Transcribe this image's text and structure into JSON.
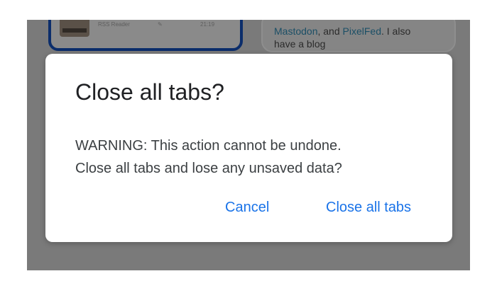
{
  "background": {
    "left_tab": {
      "title": "...",
      "source": "RSS Reader",
      "meta_icon": "comment-icon",
      "time": "21:19"
    },
    "right_tab": {
      "snippet_prefix": "",
      "link1": "Mastodon",
      "joiner": ", and ",
      "link2": "PixelFed",
      "suffix": ". I also",
      "line2": "have a blog"
    }
  },
  "dialog": {
    "title": "Close all tabs?",
    "message_line1": "WARNING: This action cannot be undone.",
    "message_line2": "Close all tabs and lose any unsaved data?",
    "cancel_label": "Cancel",
    "confirm_label": "Close all tabs",
    "accent_color": "#1a73e8"
  }
}
